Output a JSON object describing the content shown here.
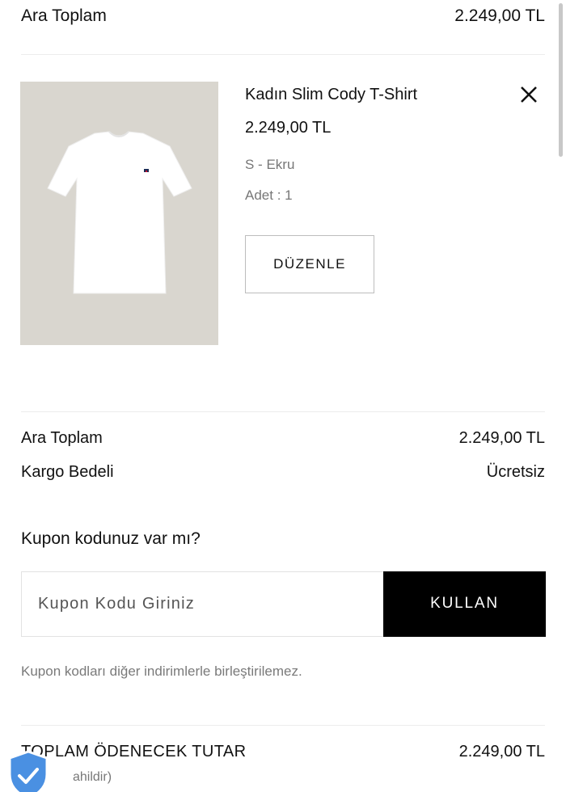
{
  "top_summary": {
    "label": "Ara Toplam",
    "value": "2.249,00 TL"
  },
  "product": {
    "name": "Kadın Slim Cody T-Shirt",
    "price": "2.249,00 TL",
    "variant": "S - Ekru",
    "quantity": "Adet : 1",
    "edit_label": "DÜZENLE",
    "image_bg": "#d9d6cf"
  },
  "summary": {
    "subtotal_label": "Ara Toplam",
    "subtotal_value": "2.249,00 TL",
    "shipping_label": "Kargo Bedeli",
    "shipping_value": "Ücretsiz"
  },
  "coupon": {
    "question": "Kupon kodunuz var mı?",
    "placeholder": "Kupon Kodu Giriniz",
    "apply_label": "KULLAN",
    "note": "Kupon kodları diğer indirimlerle birleştirilemez."
  },
  "total": {
    "label": "TOPLAM ÖDENECEK TUTAR",
    "value": "2.249,00 TL",
    "sub": "ahildir)"
  },
  "icons": {
    "remove": "close-icon",
    "badge": "shield-check-icon"
  },
  "colors": {
    "accent": "#000000",
    "muted": "#777777",
    "badge": "#4a90e2"
  }
}
